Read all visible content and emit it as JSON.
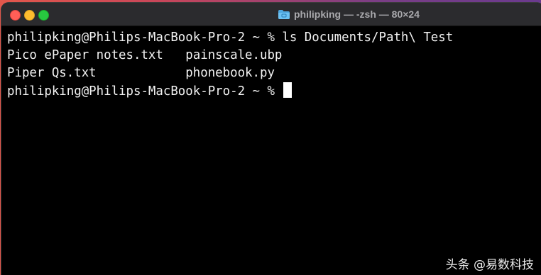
{
  "window": {
    "title": "philipking — -zsh — 80×24",
    "title_icon": "folder-icon",
    "traffic_lights": {
      "close_color": "#ff5f57",
      "minimize_color": "#febc2e",
      "maximize_color": "#28c840"
    }
  },
  "terminal": {
    "lines": [
      "philipking@Philips-MacBook-Pro-2 ~ % ls Documents/Path\\ Test",
      "Pico ePaper notes.txt   painscale.ubp",
      "Piper Qs.txt            phonebook.py"
    ],
    "prompt": "philipking@Philips-MacBook-Pro-2 ~ % "
  },
  "watermark": "头条 @易数科技"
}
